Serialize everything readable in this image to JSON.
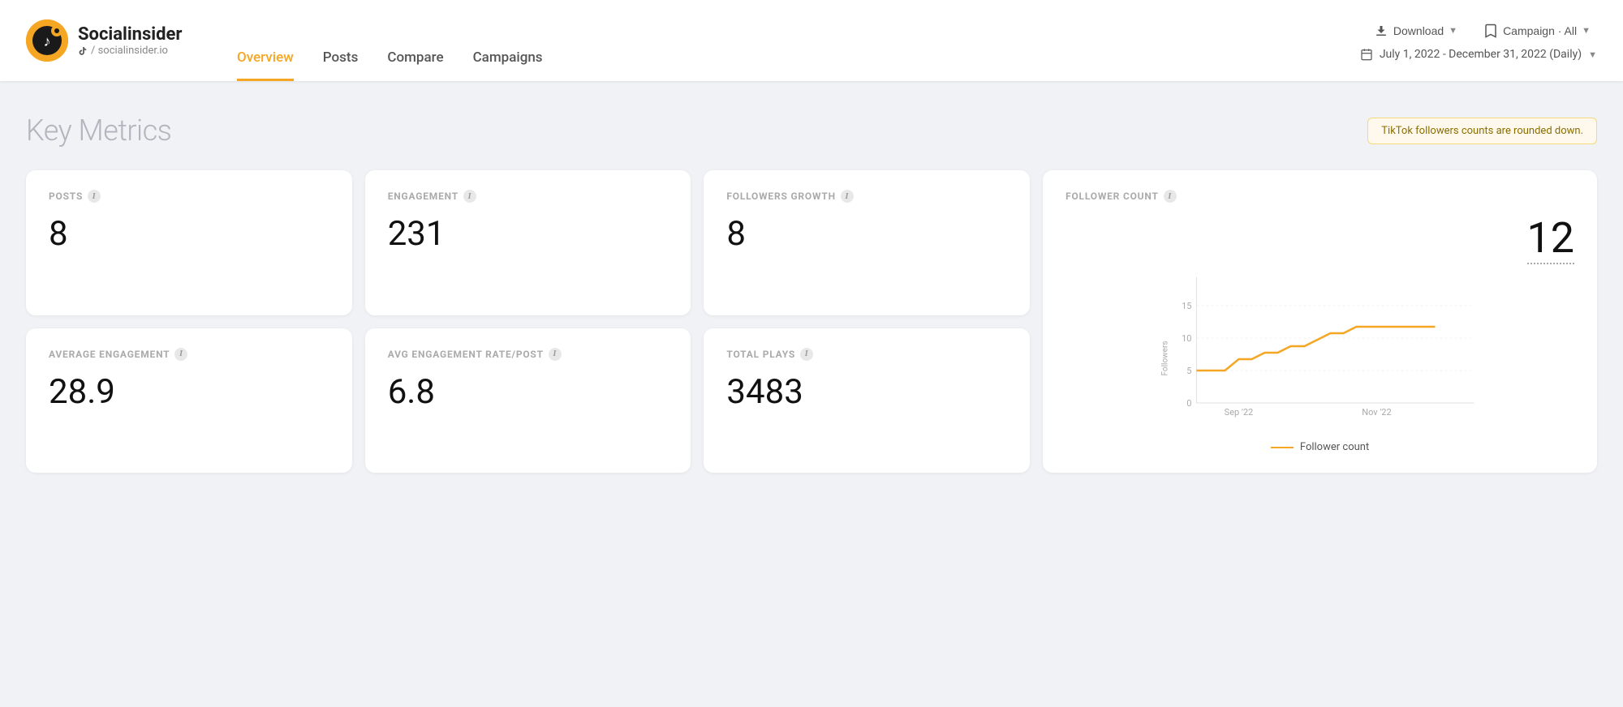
{
  "brand": {
    "name": "Socialinsider",
    "handle": "/ socialinsider.io",
    "tiktok_icon": "♪"
  },
  "nav": {
    "items": [
      {
        "label": "Overview",
        "active": true
      },
      {
        "label": "Posts",
        "active": false
      },
      {
        "label": "Compare",
        "active": false
      },
      {
        "label": "Campaigns",
        "active": false
      }
    ]
  },
  "header": {
    "download_label": "Download",
    "campaign_label": "Campaign · All",
    "date_range": "July 1, 2022 - December 31, 2022 (Daily)"
  },
  "section": {
    "title": "Key Metrics",
    "notice": "TikTok followers counts are rounded down."
  },
  "metrics": [
    {
      "label": "POSTS",
      "value": "8"
    },
    {
      "label": "ENGAGEMENT",
      "value": "231"
    },
    {
      "label": "FOLLOWERS GROWTH",
      "value": "8"
    },
    {
      "label": "AVERAGE ENGAGEMENT",
      "value": "28.9"
    },
    {
      "label": "AVG ENGAGEMENT RATE/POST",
      "value": "6.8"
    },
    {
      "label": "TOTAL PLAYS",
      "value": "3483"
    }
  ],
  "follower_chart": {
    "title": "FOLLOWER COUNT",
    "current_value": "12",
    "legend_label": "Follower count",
    "y_axis_label": "Followers",
    "x_labels": [
      "Sep '22",
      "Nov '22"
    ],
    "y_labels": [
      "0",
      "5",
      "10",
      "15"
    ],
    "data_points": [
      {
        "x": 0,
        "y": 5
      },
      {
        "x": 0.1,
        "y": 5
      },
      {
        "x": 0.18,
        "y": 7
      },
      {
        "x": 0.25,
        "y": 7
      },
      {
        "x": 0.32,
        "y": 8
      },
      {
        "x": 0.38,
        "y": 8
      },
      {
        "x": 0.45,
        "y": 9
      },
      {
        "x": 0.52,
        "y": 9
      },
      {
        "x": 0.58,
        "y": 10
      },
      {
        "x": 0.65,
        "y": 11
      },
      {
        "x": 0.72,
        "y": 11
      },
      {
        "x": 0.78,
        "y": 12
      },
      {
        "x": 0.85,
        "y": 12
      },
      {
        "x": 0.92,
        "y": 12
      },
      {
        "x": 1.0,
        "y": 12
      }
    ]
  }
}
